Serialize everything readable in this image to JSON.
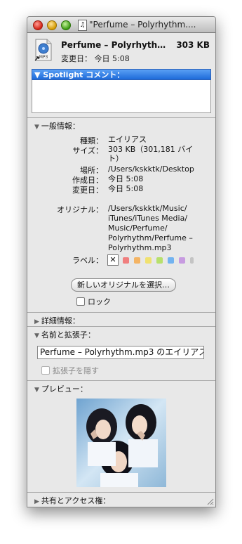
{
  "window": {
    "title": "\"Perfume – Polyrhythm....",
    "title_icon": "♫"
  },
  "header": {
    "file_name": "Perfume – Polyrhyth…",
    "file_size": "303 KB",
    "modified": "変更日：  今日 5:08"
  },
  "spotlight": {
    "label": "▼ Spotlight コメント："
  },
  "general": {
    "heading": "一般情報：",
    "kind_label": "種類：",
    "kind_value": "エイリアス",
    "size_label": "サイズ：",
    "size_value_1": "303 KB（301,181 バイ",
    "size_value_2": "ト）",
    "where_label": "場所：",
    "where_value": "/Users/kskktk/Desktop",
    "created_label": "作成日：",
    "created_value": "今日 5:08",
    "modified_label": "変更日：",
    "modified_value": "今日 5:08",
    "original_label": "オリジナル：",
    "original_lines": [
      "/Users/kskktk/Music/",
      "iTunes/iTunes Media/",
      "Music/Perfume/",
      "Polyrhythm/Perfume –",
      "Polyrhythm.mp3"
    ],
    "label_label": "ラベル：",
    "label_none": "✕",
    "label_colors": [
      "#f07f7f",
      "#f4b464",
      "#f0e170",
      "#b7e06c",
      "#72b3f0",
      "#c79be0",
      "#c4c4c4"
    ],
    "select_original_button": "新しいオリジナルを選択…",
    "lock_label": "ロック"
  },
  "more_info": {
    "heading": "詳細情報："
  },
  "name_ext": {
    "heading": "名前と拡張子：",
    "field_value": "Perfume – Polyrhythm.mp3 のエイリアス",
    "hide_ext_label": "拡張子を隠す"
  },
  "preview": {
    "heading": "プレビュー："
  },
  "sharing": {
    "heading": "共有とアクセス権："
  },
  "icons": {
    "file_icon": "mp3-alias-icon",
    "disclosure_open": "▼",
    "disclosure_closed": "▶"
  }
}
